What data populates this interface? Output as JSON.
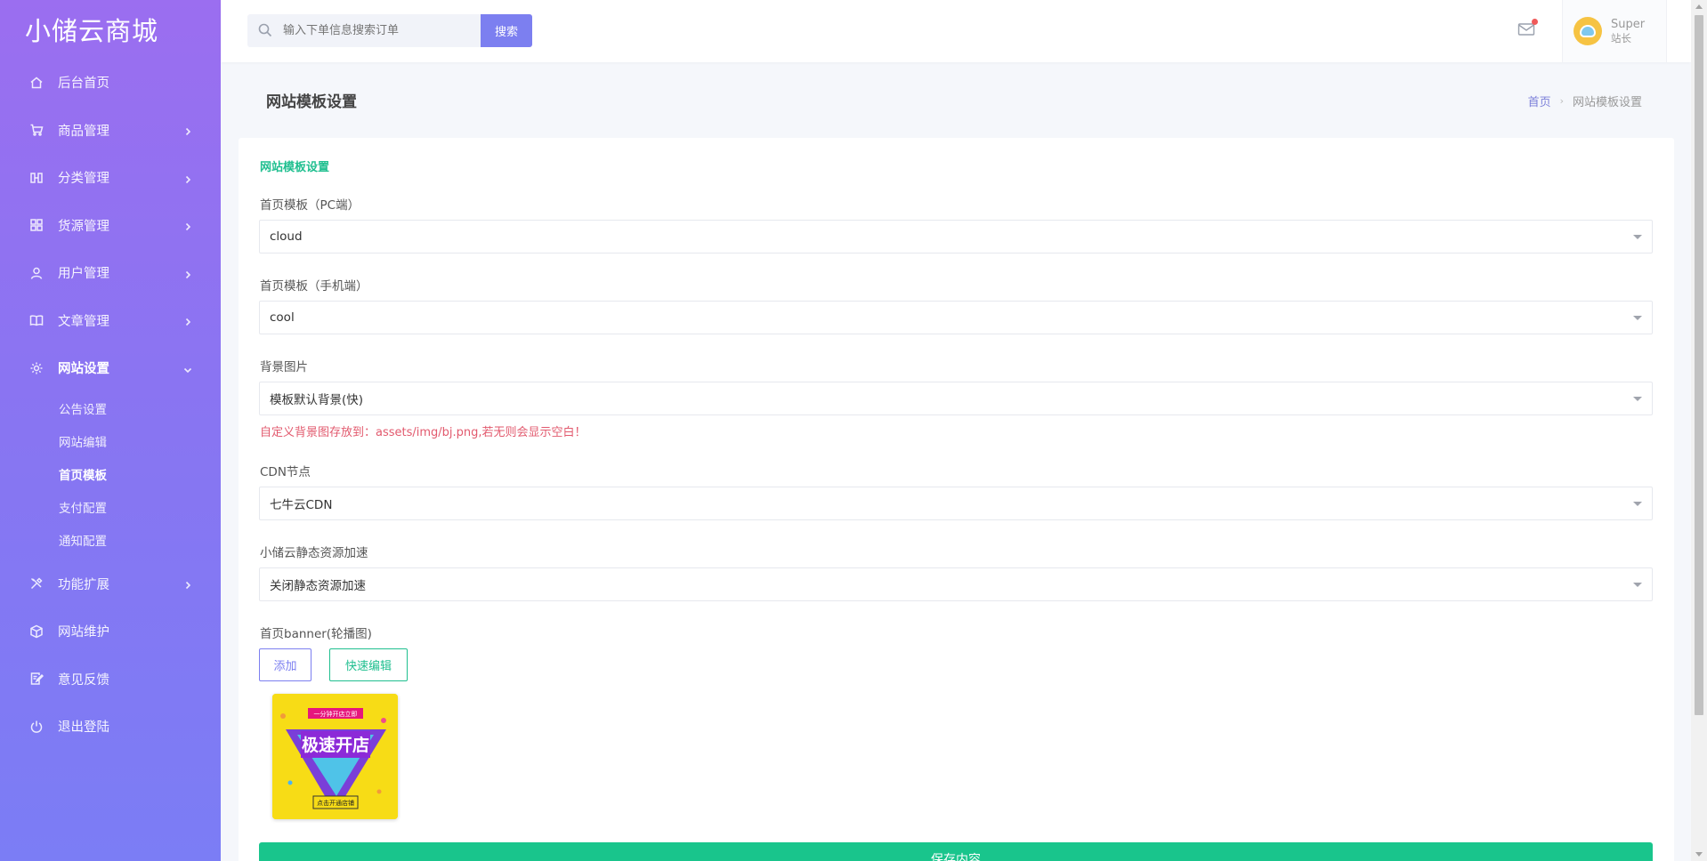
{
  "app": {
    "title": "小储云商城"
  },
  "sidebar": {
    "items": [
      {
        "label": "后台首页",
        "icon": "home-icon"
      },
      {
        "label": "商品管理",
        "icon": "cart-icon"
      },
      {
        "label": "分类管理",
        "icon": "columns-icon"
      },
      {
        "label": "货源管理",
        "icon": "grid-icon"
      },
      {
        "label": "用户管理",
        "icon": "user-icon"
      },
      {
        "label": "文章管理",
        "icon": "book-icon"
      },
      {
        "label": "网站设置",
        "icon": "gear-icon"
      },
      {
        "label": "功能扩展",
        "icon": "tools-icon"
      },
      {
        "label": "网站维护",
        "icon": "box-icon"
      },
      {
        "label": "意见反馈",
        "icon": "feedback-icon"
      },
      {
        "label": "退出登陆",
        "icon": "power-icon"
      }
    ],
    "submenu": [
      {
        "label": "公告设置"
      },
      {
        "label": "网站编辑"
      },
      {
        "label": "首页模板"
      },
      {
        "label": "支付配置"
      },
      {
        "label": "通知配置"
      }
    ]
  },
  "header": {
    "search_placeholder": "输入下单信息搜索订单",
    "search_button": "搜索",
    "user_name": "Super",
    "user_role": "站长"
  },
  "page": {
    "title": "网站模板设置",
    "breadcrumb_home": "首页",
    "breadcrumb_current": "网站模板设置"
  },
  "form": {
    "section_title": "网站模板设置",
    "pc_template_label": "首页模板（PC端）",
    "pc_template_value": "cloud",
    "mobile_template_label": "首页模板（手机端）",
    "mobile_template_value": "cool",
    "background_label": "背景图片",
    "background_value": "模板默认背景(快)",
    "background_hint": "自定义背景图存放到：assets/img/bj.png,若无则会显示空白！",
    "cdn_label": "CDN节点",
    "cdn_value": "七牛云CDN",
    "static_label": "小储云静态资源加速",
    "static_value": "关闭静态资源加速",
    "banner_label": "首页banner(轮播图)",
    "add_button": "添加",
    "quick_edit_button": "快速编辑",
    "banner_image": {
      "top_text": "一分钟开店立即",
      "main_text": "极速开店",
      "bottom_text": "点击开通店铺"
    },
    "save_button": "保存内容"
  },
  "colors": {
    "sidebar_gradient_top": "#9b6ef0",
    "sidebar_gradient_bottom": "#7b7df5",
    "accent_purple": "#7c7ff0",
    "accent_green": "#19c58c",
    "hint_red": "#e25a6e"
  }
}
